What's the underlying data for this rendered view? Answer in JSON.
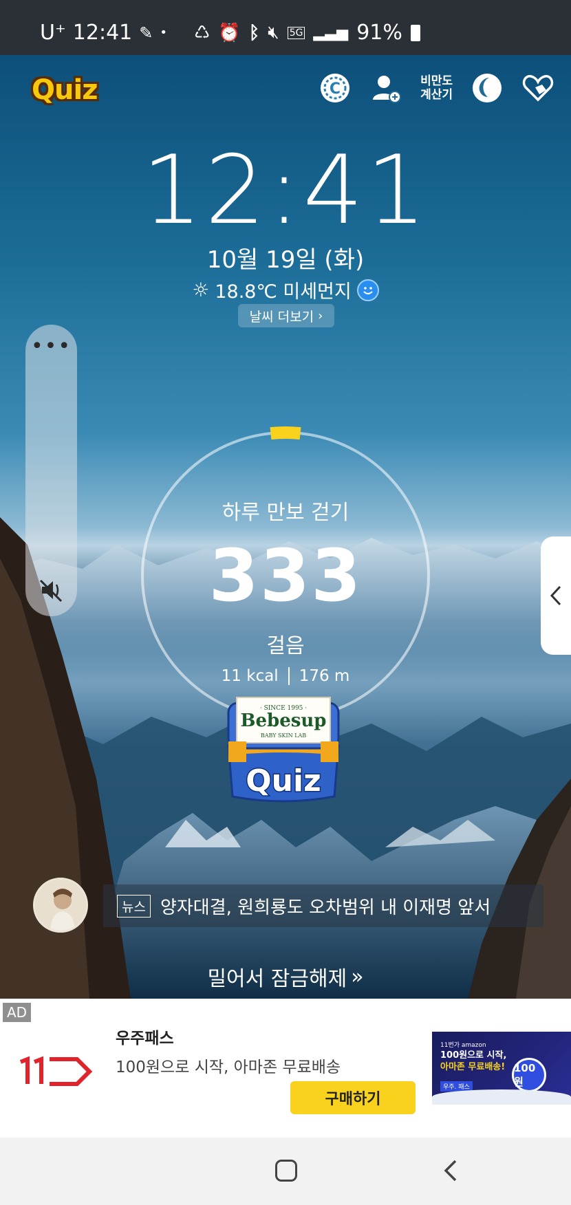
{
  "status_bar": {
    "carrier": "U⁺",
    "time": "12:41",
    "network": "5G",
    "battery": "91%"
  },
  "top": {
    "quiz_logo": "Quiz",
    "bmi_line1": "비만도",
    "bmi_line2": "계산기"
  },
  "clock": {
    "time": "12:41",
    "date": "10월 19일 (화)",
    "weather": "18.8℃ 미세먼지",
    "weather_more": "날씨 더보기"
  },
  "side_slider": {
    "dots": "•••"
  },
  "steps": {
    "title": "하루 만보 걷기",
    "count": "333",
    "unit": "걸음",
    "kcal": "11 kcal",
    "distance": "176 m",
    "progress": 0.033
  },
  "chest": {
    "brand": "Bebesup",
    "since": "· SINCE 1995 ·",
    "sub": "BABY SKIN LAB",
    "quiz": "Quiz"
  },
  "news": {
    "tag": "뉴스",
    "headline": "양자대결, 원희룡도 오차범위 내 이재명 앞서"
  },
  "unlock": "밀어서 잠금해제",
  "ad": {
    "label": "AD",
    "title": "우주패스",
    "desc": "100원으로 시작, 아마존 무료배송",
    "button": "구매하기",
    "img_brand": "11번가 amazon",
    "img_line1": "100원으로 시작,",
    "img_line2": "아마존 무료배송!",
    "img_coin": "100원",
    "img_pass": "우주. 패스"
  },
  "colors": {
    "accent_yellow": "#f8d21c",
    "ad_red": "#e1242b",
    "nav_bg": "#f2f2f2"
  }
}
